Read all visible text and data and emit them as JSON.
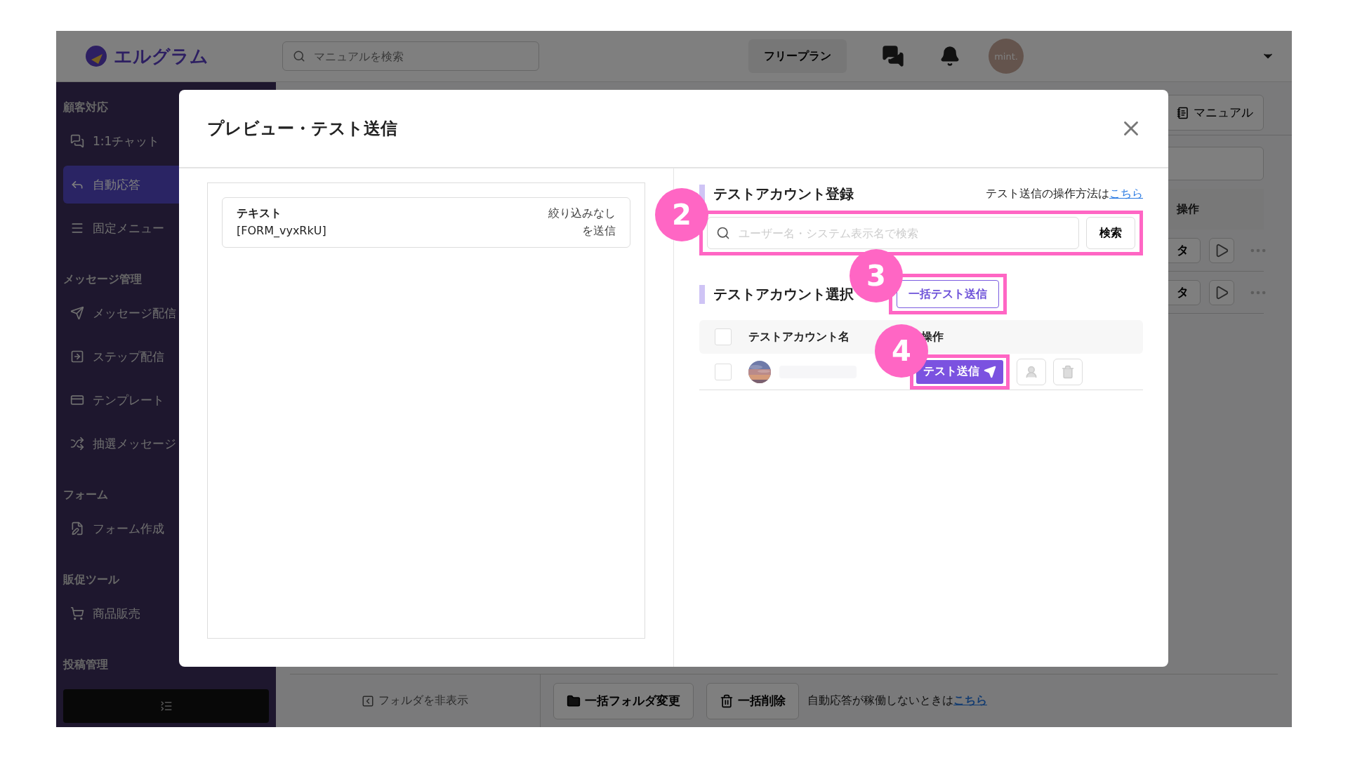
{
  "app": {
    "logo": "エルグラム",
    "search": {
      "placeholder": "マニュアルを検索"
    },
    "plan": "フリープラン",
    "avatar": "mint."
  },
  "sidebar": {
    "sections": [
      {
        "title": "顧客対応",
        "items": [
          {
            "label": "1:1チャット",
            "selected": false
          },
          {
            "label": "自動応答",
            "selected": true
          },
          {
            "label": "固定メニュー",
            "selected": false
          }
        ]
      },
      {
        "title": "メッセージ管理",
        "items": [
          {
            "label": "メッセージ配信",
            "selected": false
          },
          {
            "label": "ステップ配信",
            "selected": false
          },
          {
            "label": "テンプレート",
            "selected": false
          },
          {
            "label": "抽選メッセージ",
            "selected": false
          }
        ]
      },
      {
        "title": "フォーム",
        "items": [
          {
            "label": "フォーム作成",
            "selected": false
          }
        ]
      },
      {
        "title": "販促ツール",
        "items": [
          {
            "label": "商品販売",
            "selected": false
          }
        ]
      },
      {
        "title": "投稿管理"
      }
    ]
  },
  "background": {
    "manual_button": "マニュアル",
    "column_header": "操作",
    "rows": [
      {
        "button": "タ"
      },
      {
        "button": "タ"
      }
    ]
  },
  "bottom_bar": {
    "hide_folders": "フォルダを非表示",
    "buttons": [
      "一括フォルダ変更",
      "一括削除"
    ],
    "notice": "自動応答が稼働しないときは",
    "notice_link": "こちら"
  },
  "modal": {
    "title": "プレビュー・テスト送信",
    "preview": {
      "type_label": "テキスト",
      "content": "[FORM_vyxRkU]",
      "filter": "絞り込みなし",
      "action": "を送信"
    },
    "register": {
      "heading": "テストアカウント登録",
      "help_text": "テスト送信の操作方法は",
      "help_link": "こちら",
      "search_placeholder": "ユーザー名・システム表示名で検索",
      "search_button": "検索"
    },
    "select": {
      "heading": "テストアカウント選択",
      "bulk_button": "一括テスト送信",
      "columns": [
        "テストアカウント名",
        "操作"
      ],
      "select_all_checked": false,
      "rows": [
        {
          "checked": false,
          "send_button": "テスト送信"
        }
      ]
    }
  },
  "annotations": [
    {
      "number": "2"
    },
    {
      "number": "3"
    },
    {
      "number": "4"
    }
  ]
}
